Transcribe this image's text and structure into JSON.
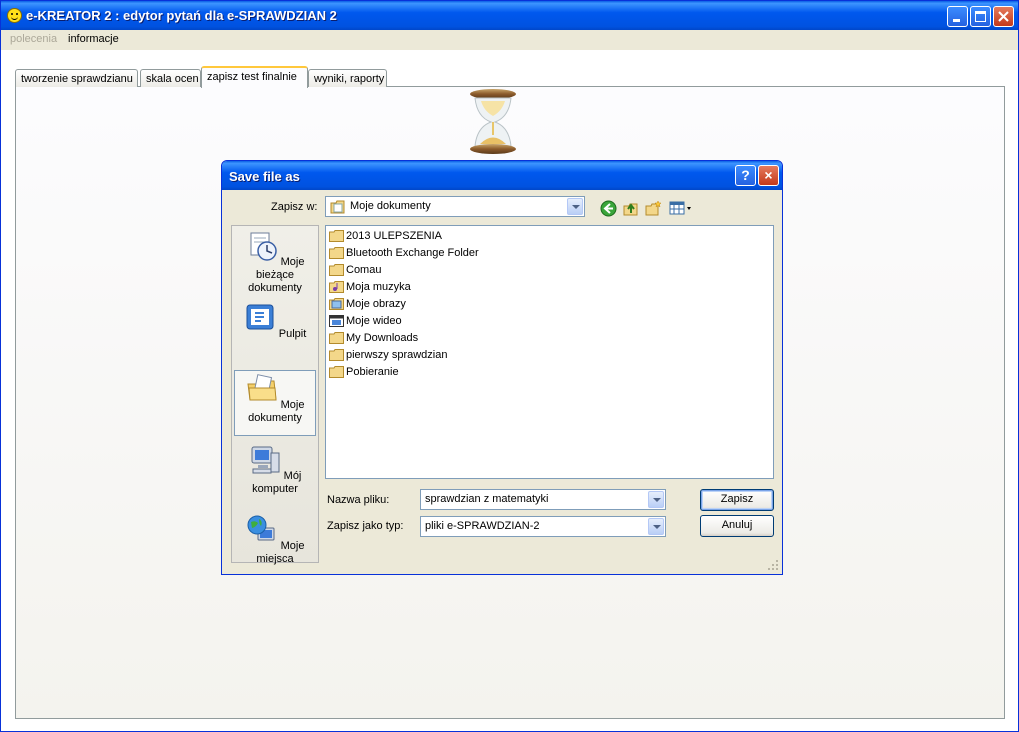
{
  "app": {
    "title": "e-KREATOR 2 : edytor pytań dla e-SPRAWDZIAN 2"
  },
  "menu": [
    {
      "label": "polecenia",
      "disabled": true
    },
    {
      "label": "informacje",
      "disabled": false
    }
  ],
  "tabs": [
    {
      "label": "tworzenie sprawdzianu",
      "active": false
    },
    {
      "label": "skala ocen",
      "active": false
    },
    {
      "label": "zapisz test finalnie",
      "active": true
    },
    {
      "label": "wyniki, raporty",
      "active": false
    }
  ],
  "dialog": {
    "title": "Save file as",
    "help_label": "?",
    "close_label": "×",
    "save_in_label": "Zapisz w:",
    "save_in_value": "Moje dokumenty",
    "places": [
      {
        "label": "Moje bieżące dokumenty",
        "icon": "recent-documents-icon"
      },
      {
        "label": "Pulpit",
        "icon": "desktop-icon"
      },
      {
        "label": "Moje dokumenty",
        "icon": "my-documents-icon",
        "selected": true
      },
      {
        "label": "Mój komputer",
        "icon": "my-computer-icon"
      },
      {
        "label": "Moje miejsca",
        "icon": "network-places-icon"
      }
    ],
    "files": [
      {
        "name": "2013 ULEPSZENIA",
        "icon": "folder-icon"
      },
      {
        "name": "Bluetooth Exchange Folder",
        "icon": "folder-icon"
      },
      {
        "name": "Comau",
        "icon": "folder-icon"
      },
      {
        "name": "Moja muzyka",
        "icon": "music-folder-icon"
      },
      {
        "name": "Moje obrazy",
        "icon": "pictures-folder-icon"
      },
      {
        "name": "Moje wideo",
        "icon": "video-folder-icon"
      },
      {
        "name": "My Downloads",
        "icon": "folder-icon"
      },
      {
        "name": "pierwszy sprawdzian",
        "icon": "folder-icon"
      },
      {
        "name": "Pobieranie",
        "icon": "folder-icon"
      }
    ],
    "filename_label": "Nazwa pliku:",
    "filename_value": "sprawdzian z matematyki",
    "filetype_label": "Zapisz jako typ:",
    "filetype_value": "pliki e-SPRAWDZIAN-2",
    "save_button": "Zapisz",
    "cancel_button": "Anuluj"
  },
  "colors": {
    "titlebar": "#0058ee",
    "dialog_bg": "#ece9d8",
    "active_tab_accent": "#ffc83c"
  }
}
